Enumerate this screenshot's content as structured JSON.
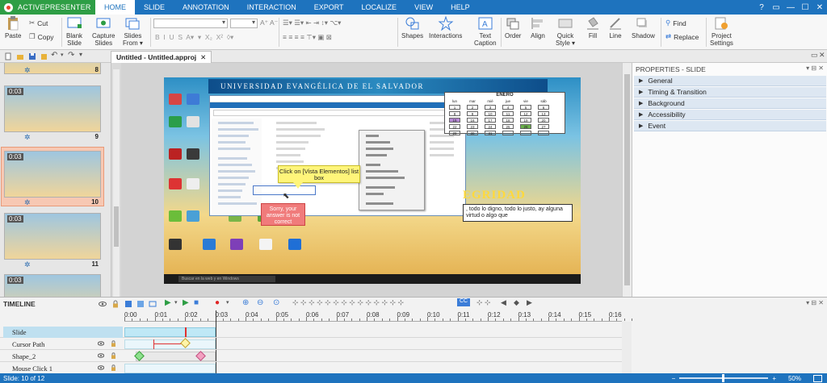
{
  "app": {
    "name": "ACTIVEPRESENTER",
    "brand_color": "#2e9e45",
    "accent_color": "#1e73be"
  },
  "menu": {
    "tabs": [
      "HOME",
      "SLIDE",
      "ANNOTATION",
      "INTERACTION",
      "EXPORT",
      "LOCALIZE",
      "VIEW",
      "HELP"
    ],
    "active": "HOME"
  },
  "ribbon": {
    "paste": "Paste",
    "cut": "Cut",
    "copy": "Copy",
    "blank_slide": [
      "Blank",
      "Slide"
    ],
    "capture_slides": [
      "Capture",
      "Slides"
    ],
    "slides_from": [
      "Slides",
      "From ▾"
    ],
    "shapes": "Shapes",
    "interactions": "Interactions",
    "text_caption": [
      "Text",
      "Caption"
    ],
    "order": "Order",
    "align": "Align",
    "quick_style": [
      "Quick",
      "Style ▾"
    ],
    "fill": "Fill",
    "line": "Line",
    "shadow": "Shadow",
    "find": "Find",
    "replace": "Replace",
    "project_settings": [
      "Project",
      "Settings"
    ]
  },
  "document": {
    "tab_title": "Untitled - Untitled.approj",
    "close_glyph": "✕"
  },
  "thumbnails": [
    {
      "number": "8",
      "duration": ""
    },
    {
      "number": "9",
      "duration": "0:03"
    },
    {
      "number": "10",
      "duration": "0:03",
      "selected": true
    },
    {
      "number": "11",
      "duration": "0:03"
    },
    {
      "number": "",
      "duration": "0:03"
    }
  ],
  "slide": {
    "banner_text": "UNIVERSIDAD EVANGÉLICA DE EL SALVADOR",
    "calendar_title": "ENERO",
    "calendar_head": [
      "lun",
      "mar",
      "mié",
      "jue",
      "vie",
      "sáb"
    ],
    "calendar_rows": [
      [
        "1",
        "2",
        "3",
        "4",
        "5",
        "6"
      ],
      [
        "8",
        "9",
        "10",
        "11",
        "12",
        "13"
      ],
      [
        "15",
        "16",
        "17",
        "18",
        "19",
        "20"
      ],
      [
        "22",
        "23",
        "24",
        "25",
        "26",
        "27"
      ],
      [
        "29",
        "30",
        "31",
        "",
        "",
        ""
      ]
    ],
    "integrity_text": "EGRIDAD",
    "quote_text": ", todo lo digno, todo lo justo, ay alguna virtud o algo que",
    "taskbar_search": "Buscar en la web y en Windows"
  },
  "callouts": {
    "click_text": "Click on [Vista Elementos] list box",
    "sorry_text": "Sorry, your answer is not correct"
  },
  "properties": {
    "title": "PROPERTIES - SLIDE",
    "sections": [
      "General",
      "Timing & Transition",
      "Background",
      "Accessibility",
      "Event"
    ]
  },
  "timeline": {
    "title": "TIMELINE",
    "ruler_labels": [
      "0:00",
      "0:01",
      "0:02",
      "0:03",
      "0:04",
      "0:05",
      "0:06",
      "0:07",
      "0:08",
      "0:09",
      "0:10",
      "0:11",
      "0:12",
      "0:13",
      "0:14",
      "0:15",
      "0:16"
    ],
    "tracks": [
      "Slide",
      "Cursor Path",
      "Shape_2",
      "Mouse Click 1"
    ]
  },
  "status": {
    "slide_info": "Slide: 10 of 12",
    "zoom": "50%",
    "zoom_level": 0.5
  }
}
